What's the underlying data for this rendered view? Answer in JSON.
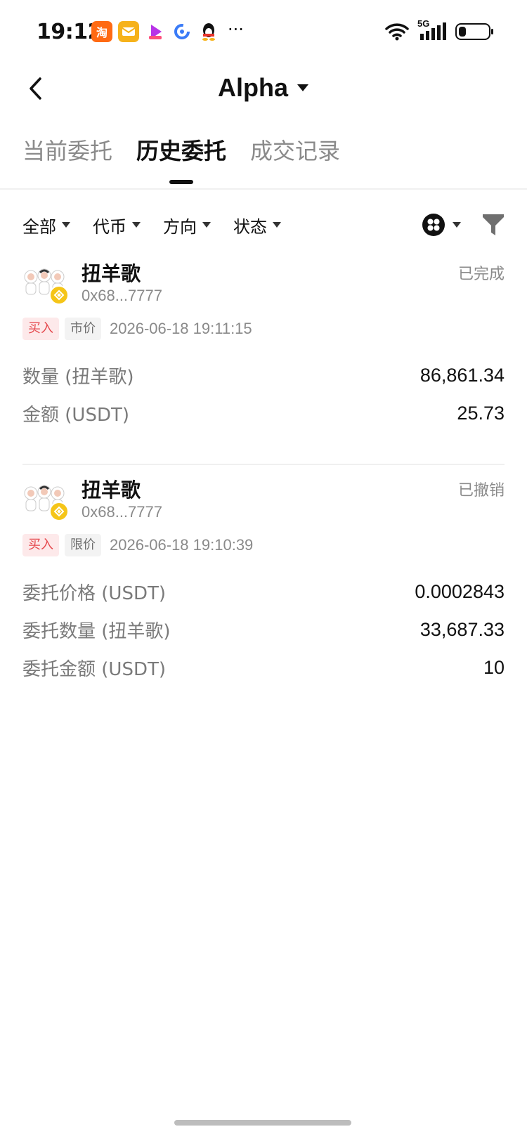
{
  "status_bar": {
    "time": "19:12",
    "network": "5G",
    "more": "···",
    "battery_level": 0.25,
    "app_icons": [
      "taobao-icon",
      "mail-icon",
      "video-icon",
      "browser-icon",
      "qq-icon"
    ]
  },
  "header": {
    "title": "Alpha"
  },
  "tabs": [
    {
      "label": "当前委托",
      "active": false
    },
    {
      "label": "历史委托",
      "active": true
    },
    {
      "label": "成交记录",
      "active": false
    }
  ],
  "filters": [
    {
      "label": "全部"
    },
    {
      "label": "代币"
    },
    {
      "label": "方向"
    },
    {
      "label": "状态"
    }
  ],
  "orders": [
    {
      "token": "扭羊歌",
      "address": "0x68...7777",
      "status": "已完成",
      "side": "买入",
      "type": "市价",
      "time": "2026-06-18 19:11:15",
      "fields": [
        {
          "label": "数量 (扭羊歌)",
          "value": "86,861.34"
        },
        {
          "label": "金额 (USDT)",
          "value": "25.73"
        }
      ]
    },
    {
      "token": "扭羊歌",
      "address": "0x68...7777",
      "status": "已撤销",
      "side": "买入",
      "type": "限价",
      "time": "2026-06-18 19:10:39",
      "fields": [
        {
          "label": "委托价格 (USDT)",
          "value": "0.0002843"
        },
        {
          "label": "委托数量 (扭羊歌)",
          "value": "33,687.33"
        },
        {
          "label": "委托金额 (USDT)",
          "value": "10"
        }
      ]
    }
  ],
  "colors": {
    "buy": "#e5484d",
    "buy_bg": "#fde9ea",
    "muted": "#8a8a8a",
    "badge": "#f5c518"
  }
}
